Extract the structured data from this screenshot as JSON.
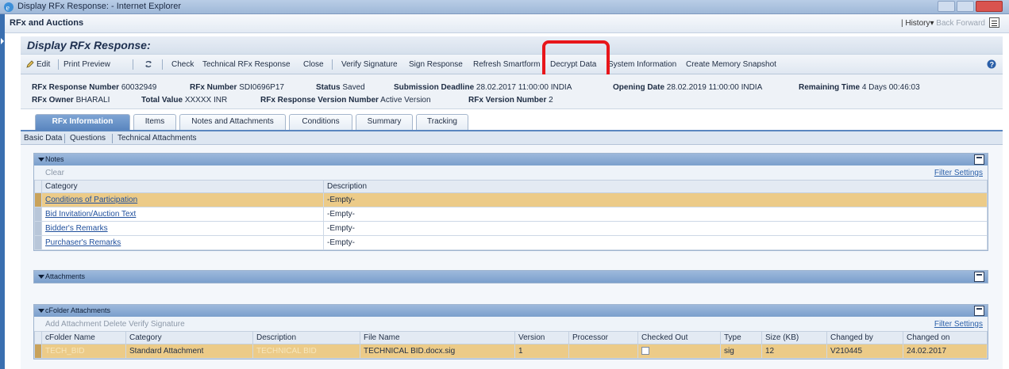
{
  "window": {
    "title": "Display RFx Response: - Internet Explorer"
  },
  "portal": {
    "app_title": "RFx and Auctions",
    "history": "History",
    "back": "Back",
    "forward": "Forward"
  },
  "page": {
    "title": "Display RFx Response:"
  },
  "toolbar": {
    "edit": "Edit",
    "print_preview": "Print Preview",
    "check": "Check",
    "technical_rfx_response": "Technical RFx Response",
    "close": "Close",
    "verify_signature": "Verify Signature",
    "sign_response": "Sign Response",
    "refresh_smartform": "Refresh Smartform",
    "decrypt_data": "Decrypt Data",
    "system_information": "System Information",
    "create_memory_snapshot": "Create Memory Snapshot"
  },
  "header": {
    "rfx_response_number_label": "RFx Response Number",
    "rfx_response_number": "60032949",
    "rfx_number_label": "RFx Number",
    "rfx_number": "SDI0696P17",
    "status_label": "Status",
    "status": "Saved",
    "submission_deadline_label": "Submission Deadline",
    "submission_deadline": "28.02.2017 11:00:00 INDIA",
    "opening_date_label": "Opening Date",
    "opening_date": "28.02.2019 11:00:00 INDIA",
    "remaining_time_label": "Remaining Time",
    "remaining_time": "4 Days 00:46:03",
    "rfx_owner_label": "RFx Owner",
    "rfx_owner": "BHARALI",
    "total_value_label": "Total Value",
    "total_value": "XXXXX INR",
    "rfx_response_version_number_label": "RFx Response Version Number",
    "rfx_response_version_number": "Active Version",
    "rfx_version_number_label": "RFx Version Number",
    "rfx_version_number": "2"
  },
  "tabs": [
    "RFx Information",
    "Items",
    "Notes and Attachments",
    "Conditions",
    "Summary",
    "Tracking"
  ],
  "subnav": [
    "Basic Data",
    "Questions",
    "Technical Attachments"
  ],
  "notes": {
    "title": "Notes",
    "clear": "Clear",
    "filter": "Filter",
    "settings": "Settings",
    "columns": [
      "Category",
      "Description"
    ],
    "rows": [
      [
        "Conditions of Participation",
        "-Empty-"
      ],
      [
        "Bid Invitation/Auction Text",
        "-Empty-"
      ],
      [
        "Bidder's Remarks",
        "-Empty-"
      ],
      [
        "Purchaser's Remarks",
        "-Empty-"
      ]
    ]
  },
  "attachments": {
    "title": "Attachments"
  },
  "cfolder": {
    "title": "cFolder Attachments",
    "add_attachment": "Add Attachment",
    "delete": "Delete",
    "verify_signature": "Verify Signature",
    "filter": "Filter",
    "settings": "Settings",
    "columns": [
      "cFolder Name",
      "Category",
      "Description",
      "File Name",
      "Version",
      "Processor",
      "Checked Out",
      "Type",
      "Size (KB)",
      "Changed by",
      "Changed on"
    ],
    "row": {
      "cfolder_name": "TECH_BID",
      "category": "Standard Attachment",
      "description": "TECHNICAL BID",
      "file_name": "TECHNICAL BID.docx.sig",
      "version": "1",
      "processor": "",
      "type": "sig",
      "size_kb": "12",
      "changed_by": "V210445",
      "changed_on": "24.02.2017"
    }
  },
  "colors": {
    "highlight": "#e8161b",
    "selected_row": "#eccb88",
    "tray_header": "#7b9fcc"
  }
}
